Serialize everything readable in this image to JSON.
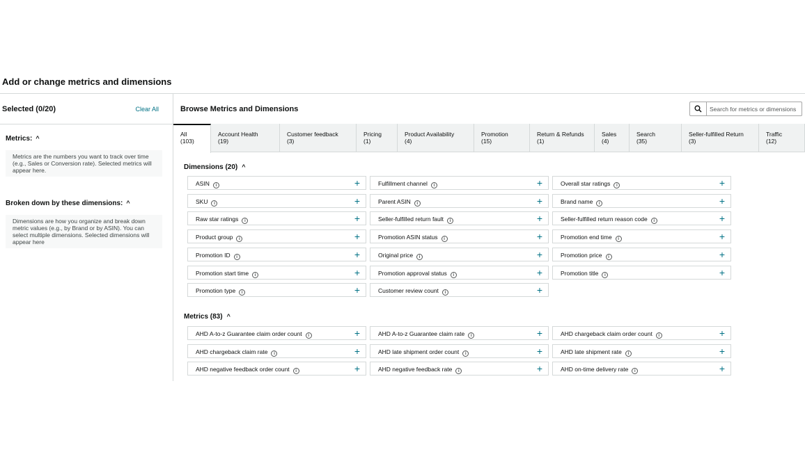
{
  "page": {
    "title": "Add or change metrics and dimensions"
  },
  "left": {
    "selected_title": "Selected (0/20)",
    "clear_all": "Clear All",
    "metrics_label": "Metrics:",
    "metrics_hint": "Metrics are the numbers you want to track over time (e.g., Sales or Conversion rate). Selected metrics will appear here.",
    "dimensions_label": "Broken down by these dimensions:",
    "dimensions_hint": "Dimensions are how you organize and break down metric values (e.g., by Brand or by ASIN). You can select multiple dimensions. Selected dimensions will appear here"
  },
  "browse": {
    "title": "Browse Metrics and Dimensions",
    "search_placeholder": "Search for metrics or dimensions",
    "tabs": [
      {
        "name": "All",
        "count": "(103)"
      },
      {
        "name": "Account Health",
        "count": "(19)"
      },
      {
        "name": "Customer feedback",
        "count": "(3)"
      },
      {
        "name": "Pricing",
        "count": "(1)"
      },
      {
        "name": "Product Availability",
        "count": "(4)"
      },
      {
        "name": "Promotion",
        "count": "(15)"
      },
      {
        "name": "Return & Refunds",
        "count": "(1)"
      },
      {
        "name": "Sales",
        "count": "(4)"
      },
      {
        "name": "Search",
        "count": "(35)"
      },
      {
        "name": "Seller-fulfilled Return",
        "count": "(3)"
      },
      {
        "name": "Traffic",
        "count": "(12)"
      }
    ],
    "dimensions_title": "Dimensions (20)",
    "dimensions": [
      "ASIN",
      "Fulfillment channel",
      "Overall star ratings",
      "SKU",
      "Parent ASIN",
      "Brand name",
      "Raw star ratings",
      "Seller-fulfilled return fault",
      "Seller-fulfilled return reason code",
      "Product group",
      "Promotion ASIN status",
      "Promotion end time",
      "Promotion ID",
      "Original price",
      "Promotion price",
      "Promotion start time",
      "Promotion approval status",
      "Promotion title",
      "Promotion type",
      "Customer review count"
    ],
    "metrics_title": "Metrics (83)",
    "metrics": [
      "AHD A-to-z Guarantee claim order count",
      "AHD A-to-z Guarantee claim rate",
      "AHD chargeback claim order count",
      "AHD chargeback claim rate",
      "AHD late shipment order count",
      "AHD late shipment rate",
      "AHD negative feedback order count",
      "AHD negative feedback rate",
      "AHD on-time delivery rate"
    ]
  },
  "icons": {
    "search": "search-icon",
    "info": "info-icon",
    "add": "plus-icon",
    "collapse": "chevron-up-icon"
  },
  "colors": {
    "link": "#007185",
    "border": "#d5d9d9",
    "tabs_bg": "#f0f2f2"
  }
}
